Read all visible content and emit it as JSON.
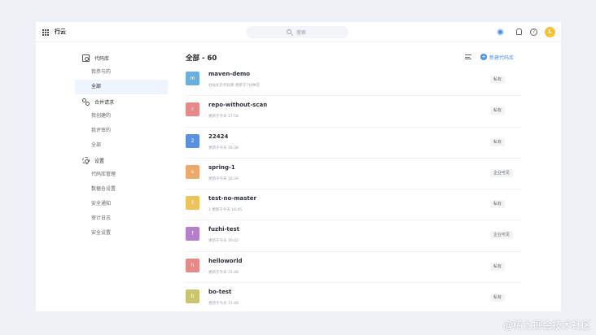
{
  "topbar": {
    "app_title": "行云",
    "search_placeholder": "搜索",
    "avatar_letter": "L"
  },
  "sidebar": {
    "groups": [
      {
        "label": "代码库",
        "icon": "repo-icon",
        "items": [
          {
            "label": "我参与的",
            "active": false
          },
          {
            "label": "全部",
            "active": true
          }
        ]
      },
      {
        "label": "合并请求",
        "icon": "merge-request-icon",
        "items": [
          {
            "label": "我创建的",
            "active": false
          },
          {
            "label": "我评审的",
            "active": false
          },
          {
            "label": "全部",
            "active": false
          }
        ]
      },
      {
        "label": "设置",
        "icon": "gear-icon",
        "items": [
          {
            "label": "代码库管理",
            "active": false
          },
          {
            "label": "数据仓设置",
            "active": false
          },
          {
            "label": "安全通知",
            "active": false
          },
          {
            "label": "审计日志",
            "active": false
          },
          {
            "label": "安全设置",
            "active": false
          }
        ]
      }
    ]
  },
  "main": {
    "title": "全部 - 60",
    "new_button_label": "新建代码库",
    "repos": [
      {
        "avatar": "m",
        "color": "#6ab0de",
        "name": "maven-demo",
        "meta": "驻站北京代码库   更新于7分钟前",
        "badge": "私有"
      },
      {
        "avatar": "r",
        "color": "#e58a86",
        "name": "repo-without-scan",
        "meta": "更新于今天 17:58",
        "badge": "私有"
      },
      {
        "avatar": "2",
        "color": "#5b8fe0",
        "name": "22424",
        "meta": "更新于今天 16:38",
        "badge": "私有"
      },
      {
        "avatar": "s",
        "color": "#eba96b",
        "name": "spring-1",
        "meta": "更新于今天 16:39",
        "badge": "企业可见"
      },
      {
        "avatar": "t",
        "color": "#ecc45a",
        "name": "test-no-master",
        "meta": "1   更新于今天 16:05",
        "badge": "私有"
      },
      {
        "avatar": "f",
        "color": "#b47fcc",
        "name": "fuzhi-test",
        "meta": "更新于今天 16:02",
        "badge": "企业可见"
      },
      {
        "avatar": "h",
        "color": "#e58a86",
        "name": "helloworld",
        "meta": "更新于今天 15:48",
        "badge": "私有"
      },
      {
        "avatar": "b",
        "color": "#c9c56e",
        "name": "bo-test",
        "meta": "更新于今天 15:48",
        "badge": "私有"
      }
    ]
  },
  "watermark": "@稀土掘金技术社区",
  "colors": {
    "accent": "#4a90e2",
    "active_bg": "#eef5ff"
  }
}
